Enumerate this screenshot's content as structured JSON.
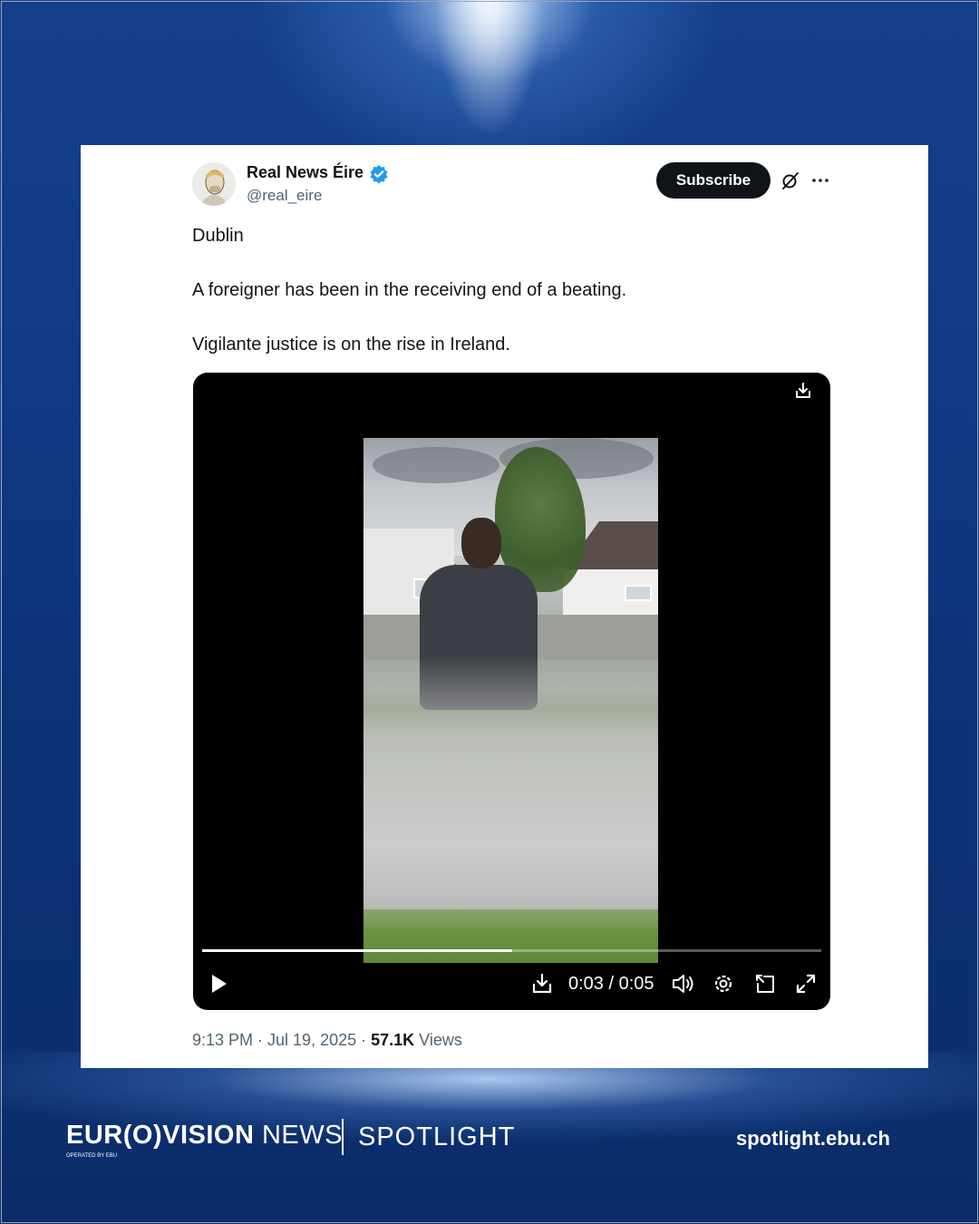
{
  "post": {
    "author_name": "Real News Éire",
    "author_handle": "@real_eire",
    "subscribe_label": "Subscribe",
    "text_lines": [
      "Dublin",
      "A foreigner has been in the receiving end of a beating.",
      "Vigilante justice is on the rise in Ireland."
    ],
    "timestamp": "9:13 PM · Jul 19, 2025 · ",
    "views_count": "57.1K",
    "views_label": " Views"
  },
  "video": {
    "time_display": "0:03 / 0:05",
    "progress": 0.5
  },
  "footer": {
    "logo_bold": "EUR(O)VISION",
    "logo_light": " NEWS",
    "logo_sub": "OPERATED BY EBU",
    "section": "SPOTLIGHT",
    "url": "spotlight.ebu.ch"
  },
  "colors": {
    "background": "#0e2f6b",
    "verified": "#1d9bf0",
    "subscribe_bg": "#0f1419"
  },
  "icons": [
    "verified-badge-icon",
    "grok-icon",
    "more-icon",
    "download-icon",
    "play-icon",
    "volume-icon",
    "settings-icon",
    "pip-icon",
    "fullscreen-icon"
  ]
}
